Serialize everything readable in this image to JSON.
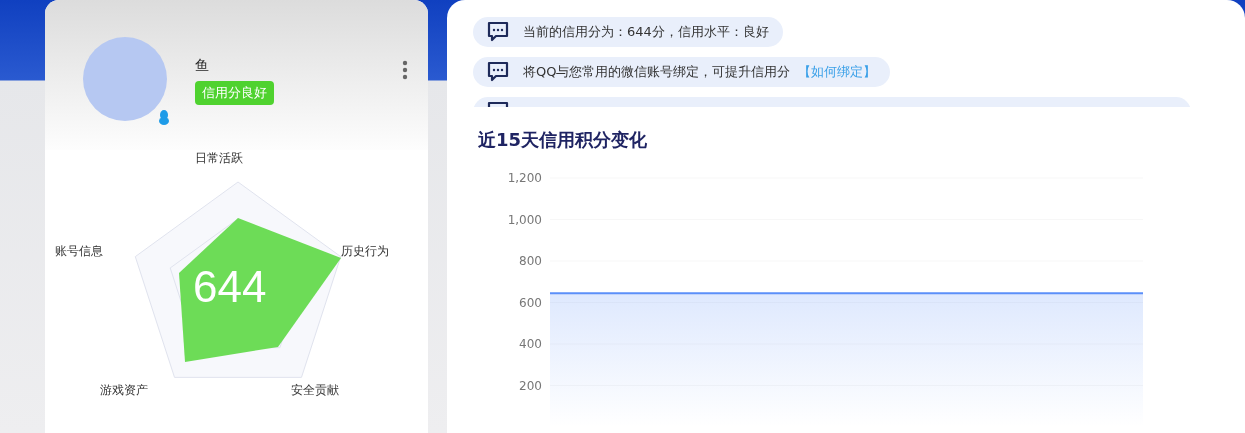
{
  "profile": {
    "name": "鱼",
    "badge": "信用分良好",
    "score": "644",
    "radar_labels": [
      "日常活跃",
      "历史行为",
      "安全贡献",
      "游戏资产",
      "账号信息"
    ]
  },
  "notices": [
    {
      "kind": "message",
      "text": "当前的信用分为：644分，信用水平：良好"
    },
    {
      "kind": "message",
      "text": "将QQ与您常用的微信账号绑定，可提升信用分",
      "link": "【如何绑定】"
    },
    {
      "kind": "message"
    }
  ],
  "chart": {
    "title": "近15天信用积分变化",
    "chart_data": {
      "type": "area",
      "grid": true,
      "ylim": [
        0,
        1200
      ],
      "yticks": [
        {
          "value": 200,
          "label": "200"
        },
        {
          "value": 400,
          "label": "400"
        },
        {
          "value": 600,
          "label": "600"
        },
        {
          "value": 800,
          "label": "800"
        },
        {
          "value": 1000,
          "label": "1,000"
        },
        {
          "value": 1200,
          "label": "1,200"
        }
      ],
      "series": [
        {
          "color": "#5b8ff9",
          "values": [
            644,
            644,
            644,
            644,
            644,
            644,
            644,
            644,
            644,
            644,
            644,
            644,
            644,
            644,
            644
          ]
        }
      ]
    }
  }
}
